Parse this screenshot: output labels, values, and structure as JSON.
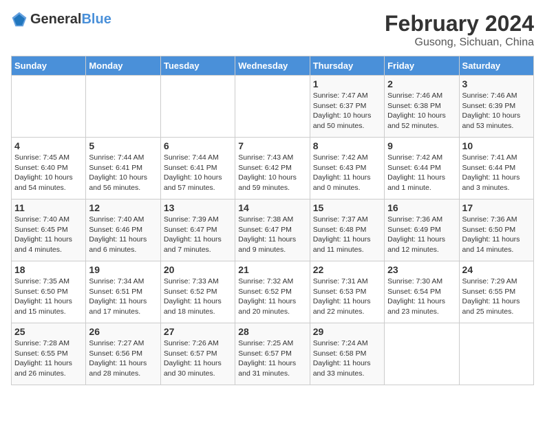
{
  "header": {
    "logo_general": "General",
    "logo_blue": "Blue",
    "title": "February 2024",
    "location": "Gusong, Sichuan, China"
  },
  "days_of_week": [
    "Sunday",
    "Monday",
    "Tuesday",
    "Wednesday",
    "Thursday",
    "Friday",
    "Saturday"
  ],
  "weeks": [
    [
      {
        "day": "",
        "info": ""
      },
      {
        "day": "",
        "info": ""
      },
      {
        "day": "",
        "info": ""
      },
      {
        "day": "",
        "info": ""
      },
      {
        "day": "1",
        "info": "Sunrise: 7:47 AM\nSunset: 6:37 PM\nDaylight: 10 hours and 50 minutes."
      },
      {
        "day": "2",
        "info": "Sunrise: 7:46 AM\nSunset: 6:38 PM\nDaylight: 10 hours and 52 minutes."
      },
      {
        "day": "3",
        "info": "Sunrise: 7:46 AM\nSunset: 6:39 PM\nDaylight: 10 hours and 53 minutes."
      }
    ],
    [
      {
        "day": "4",
        "info": "Sunrise: 7:45 AM\nSunset: 6:40 PM\nDaylight: 10 hours and 54 minutes."
      },
      {
        "day": "5",
        "info": "Sunrise: 7:44 AM\nSunset: 6:41 PM\nDaylight: 10 hours and 56 minutes."
      },
      {
        "day": "6",
        "info": "Sunrise: 7:44 AM\nSunset: 6:41 PM\nDaylight: 10 hours and 57 minutes."
      },
      {
        "day": "7",
        "info": "Sunrise: 7:43 AM\nSunset: 6:42 PM\nDaylight: 10 hours and 59 minutes."
      },
      {
        "day": "8",
        "info": "Sunrise: 7:42 AM\nSunset: 6:43 PM\nDaylight: 11 hours and 0 minutes."
      },
      {
        "day": "9",
        "info": "Sunrise: 7:42 AM\nSunset: 6:44 PM\nDaylight: 11 hours and 1 minute."
      },
      {
        "day": "10",
        "info": "Sunrise: 7:41 AM\nSunset: 6:44 PM\nDaylight: 11 hours and 3 minutes."
      }
    ],
    [
      {
        "day": "11",
        "info": "Sunrise: 7:40 AM\nSunset: 6:45 PM\nDaylight: 11 hours and 4 minutes."
      },
      {
        "day": "12",
        "info": "Sunrise: 7:40 AM\nSunset: 6:46 PM\nDaylight: 11 hours and 6 minutes."
      },
      {
        "day": "13",
        "info": "Sunrise: 7:39 AM\nSunset: 6:47 PM\nDaylight: 11 hours and 7 minutes."
      },
      {
        "day": "14",
        "info": "Sunrise: 7:38 AM\nSunset: 6:47 PM\nDaylight: 11 hours and 9 minutes."
      },
      {
        "day": "15",
        "info": "Sunrise: 7:37 AM\nSunset: 6:48 PM\nDaylight: 11 hours and 11 minutes."
      },
      {
        "day": "16",
        "info": "Sunrise: 7:36 AM\nSunset: 6:49 PM\nDaylight: 11 hours and 12 minutes."
      },
      {
        "day": "17",
        "info": "Sunrise: 7:36 AM\nSunset: 6:50 PM\nDaylight: 11 hours and 14 minutes."
      }
    ],
    [
      {
        "day": "18",
        "info": "Sunrise: 7:35 AM\nSunset: 6:50 PM\nDaylight: 11 hours and 15 minutes."
      },
      {
        "day": "19",
        "info": "Sunrise: 7:34 AM\nSunset: 6:51 PM\nDaylight: 11 hours and 17 minutes."
      },
      {
        "day": "20",
        "info": "Sunrise: 7:33 AM\nSunset: 6:52 PM\nDaylight: 11 hours and 18 minutes."
      },
      {
        "day": "21",
        "info": "Sunrise: 7:32 AM\nSunset: 6:52 PM\nDaylight: 11 hours and 20 minutes."
      },
      {
        "day": "22",
        "info": "Sunrise: 7:31 AM\nSunset: 6:53 PM\nDaylight: 11 hours and 22 minutes."
      },
      {
        "day": "23",
        "info": "Sunrise: 7:30 AM\nSunset: 6:54 PM\nDaylight: 11 hours and 23 minutes."
      },
      {
        "day": "24",
        "info": "Sunrise: 7:29 AM\nSunset: 6:55 PM\nDaylight: 11 hours and 25 minutes."
      }
    ],
    [
      {
        "day": "25",
        "info": "Sunrise: 7:28 AM\nSunset: 6:55 PM\nDaylight: 11 hours and 26 minutes."
      },
      {
        "day": "26",
        "info": "Sunrise: 7:27 AM\nSunset: 6:56 PM\nDaylight: 11 hours and 28 minutes."
      },
      {
        "day": "27",
        "info": "Sunrise: 7:26 AM\nSunset: 6:57 PM\nDaylight: 11 hours and 30 minutes."
      },
      {
        "day": "28",
        "info": "Sunrise: 7:25 AM\nSunset: 6:57 PM\nDaylight: 11 hours and 31 minutes."
      },
      {
        "day": "29",
        "info": "Sunrise: 7:24 AM\nSunset: 6:58 PM\nDaylight: 11 hours and 33 minutes."
      },
      {
        "day": "",
        "info": ""
      },
      {
        "day": "",
        "info": ""
      }
    ]
  ]
}
